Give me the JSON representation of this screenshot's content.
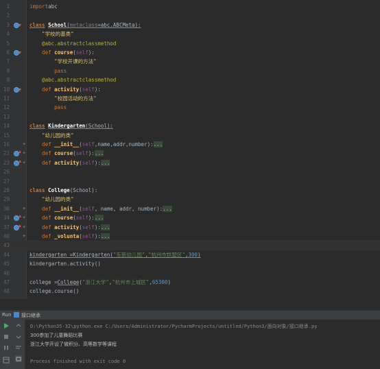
{
  "editor": {
    "lines": [
      {
        "n": "1",
        "code": [
          [
            "kwn",
            "import"
          ],
          [
            "",
            "abc"
          ]
        ]
      },
      {
        "n": "2",
        "code": []
      },
      {
        "n": "3",
        "code": [
          [
            "kw ul",
            "class"
          ],
          [
            "",
            " "
          ],
          [
            "cls ul",
            "School"
          ],
          [
            "ul",
            "("
          ],
          [
            "grey ul",
            "metaclass"
          ],
          [
            "ul",
            "=abc.ABCMeta):"
          ]
        ],
        "icon": "override-down"
      },
      {
        "n": "4",
        "code": [
          [
            "",
            ""
          ],
          [
            "str",
            "    \"学校的基类\""
          ]
        ]
      },
      {
        "n": "5",
        "code": [
          [
            "dec",
            "    @abc.abstractclassmethod"
          ]
        ]
      },
      {
        "n": "6",
        "code": [
          [
            "kwn",
            "    def "
          ],
          [
            "fn",
            "course"
          ],
          [
            "",
            "("
          ],
          [
            "self",
            "self"
          ],
          [
            "",
            "):"
          ]
        ],
        "icon": "override-down"
      },
      {
        "n": "7",
        "code": [
          [
            "str",
            "        \"学校开课的方法\""
          ]
        ]
      },
      {
        "n": "8",
        "code": [
          [
            "kwn",
            "        pass"
          ]
        ]
      },
      {
        "n": "9",
        "code": [
          [
            "dec",
            "    @abc.abstractclassmethod"
          ]
        ]
      },
      {
        "n": "10",
        "code": [
          [
            "kwn",
            "    def "
          ],
          [
            "fn",
            "activity"
          ],
          [
            "",
            "("
          ],
          [
            "self",
            "self"
          ],
          [
            "",
            "):"
          ]
        ],
        "icon": "override-down"
      },
      {
        "n": "11",
        "code": [
          [
            "str",
            "        \"校园活动的方法\""
          ]
        ]
      },
      {
        "n": "12",
        "code": [
          [
            "kwn",
            "        pass"
          ]
        ]
      },
      {
        "n": "13",
        "code": []
      },
      {
        "n": "14",
        "code": [
          [
            "kw ul",
            "class"
          ],
          [
            "",
            " "
          ],
          [
            "cls ul",
            "Kindergarten"
          ],
          [
            "ul",
            "(School):"
          ]
        ]
      },
      {
        "n": "15",
        "code": [
          [
            "str",
            "    \"幼儿园的类\""
          ]
        ]
      },
      {
        "n": "16",
        "code": [
          [
            "kwn",
            "    def "
          ],
          [
            "fn",
            "__init__"
          ],
          [
            "",
            "("
          ],
          [
            "self",
            "self"
          ],
          [
            "",
            ",name,addr,number):"
          ],
          [
            "fold-box",
            "..."
          ]
        ]
      },
      {
        "n": "22",
        "code": [
          [
            "kwn",
            "    def "
          ],
          [
            "fn",
            "course"
          ],
          [
            "",
            "("
          ],
          [
            "self",
            "self"
          ],
          [
            "",
            "):"
          ],
          [
            "fold-box",
            "..."
          ]
        ],
        "icon": "override-up"
      },
      {
        "n": "23",
        "code": [
          [
            "kwn",
            "    def "
          ],
          [
            "fn",
            "activity"
          ],
          [
            "",
            "("
          ],
          [
            "self",
            "self"
          ],
          [
            "",
            "):"
          ],
          [
            "fold-box",
            "..."
          ]
        ],
        "icon": "override-up"
      },
      {
        "n": "26",
        "code": []
      },
      {
        "n": "27",
        "code": []
      },
      {
        "n": "28",
        "code": [
          [
            "kw",
            "class"
          ],
          [
            "",
            " "
          ],
          [
            "cls",
            "College"
          ],
          [
            "",
            "(School):"
          ]
        ]
      },
      {
        "n": "29",
        "code": [
          [
            "str",
            "    \"幼儿园的类\""
          ]
        ]
      },
      {
        "n": "30",
        "code": [
          [
            "kwn",
            "    def "
          ],
          [
            "fn",
            "__init__"
          ],
          [
            "",
            "("
          ],
          [
            "self",
            "self"
          ],
          [
            "",
            ", name, addr, number):"
          ],
          [
            "fold-box",
            "..."
          ]
        ]
      },
      {
        "n": "34",
        "code": [
          [
            "kwn",
            "    def "
          ],
          [
            "fn",
            "course"
          ],
          [
            "",
            "("
          ],
          [
            "self",
            "self"
          ],
          [
            "",
            "):"
          ],
          [
            "fold-box",
            "..."
          ]
        ],
        "icon": "override-up"
      },
      {
        "n": "37",
        "code": [
          [
            "kwn",
            "    def "
          ],
          [
            "fn",
            "activity"
          ],
          [
            "",
            "("
          ],
          [
            "self",
            "self"
          ],
          [
            "",
            "):"
          ],
          [
            "fold-box",
            "..."
          ]
        ],
        "icon": "override-up"
      },
      {
        "n": "40",
        "code": [
          [
            "kwn",
            "    def "
          ],
          [
            "fn",
            "_volunta"
          ],
          [
            "",
            "("
          ],
          [
            "self",
            "self"
          ],
          [
            "",
            "):"
          ],
          [
            "fold-box",
            "..."
          ]
        ]
      },
      {
        "n": "43",
        "code": [],
        "current": true
      },
      {
        "n": "44",
        "code": [
          [
            "ul",
            "kindergarten =Kindergarten("
          ],
          [
            "strg ul",
            "\"东新幼儿园\""
          ],
          [
            "ul",
            ","
          ],
          [
            "strg ul",
            "\"杭州市拱墅区\""
          ],
          [
            "ul",
            ","
          ],
          [
            "num ul",
            "300"
          ],
          [
            "ul",
            ")"
          ]
        ]
      },
      {
        "n": "45",
        "code": [
          [
            "",
            "kindergarten.activity()"
          ]
        ]
      },
      {
        "n": "46",
        "code": []
      },
      {
        "n": "47",
        "code": [
          [
            "",
            "college ="
          ],
          [
            "ul",
            "College"
          ],
          [
            "",
            "("
          ],
          [
            "strg",
            "\"浙江大学\""
          ],
          [
            "",
            ","
          ],
          [
            "strg",
            "\"杭州市上城区\""
          ],
          [
            "",
            ","
          ],
          [
            "num",
            "65300"
          ],
          [
            "",
            ")"
          ]
        ]
      },
      {
        "n": "48",
        "code": [
          [
            "",
            "college.course()"
          ]
        ]
      }
    ]
  },
  "run": {
    "tab_label": "Run",
    "config_name": "接口继承",
    "command": "D:\\Python35-32\\python.exe C:/Users/Administrator/PycharmProjects/untitled/Python3/面向对象/接口继承.py",
    "output": [
      "300参加了儿童舞蹈比赛",
      "浙江大学开设了微积分、高等数学等课程"
    ],
    "exit": "Process finished with exit code 0"
  },
  "colors": {
    "background": "#2b2b2b",
    "keyword": "#cc7832",
    "string": "#6a8759",
    "number": "#6897bb"
  }
}
